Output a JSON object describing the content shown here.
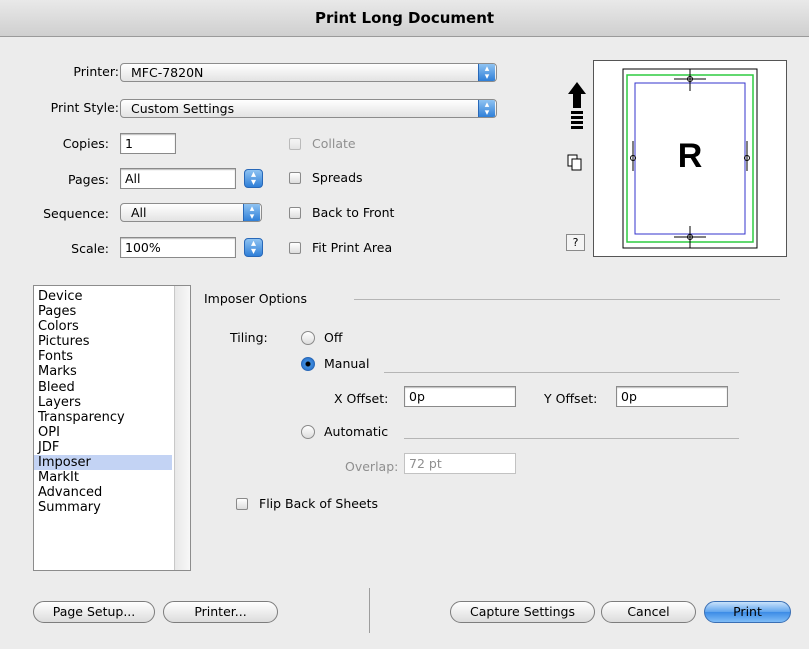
{
  "window": {
    "title": "Print Long Document"
  },
  "printer": {
    "label": "Printer:",
    "value": "MFC-7820N"
  },
  "print_style": {
    "label": "Print Style:",
    "value": "Custom Settings"
  },
  "copies": {
    "label": "Copies:",
    "value": "1"
  },
  "pages": {
    "label": "Pages:",
    "value": "All"
  },
  "sequence": {
    "label": "Sequence:",
    "value": "All"
  },
  "scale": {
    "label": "Scale:",
    "value": "100%"
  },
  "options": {
    "collate": {
      "label": "Collate",
      "checked": false,
      "enabled": false
    },
    "spreads": {
      "label": "Spreads",
      "checked": false
    },
    "back_to_front": {
      "label": "Back to Front",
      "checked": false
    },
    "fit_print_area": {
      "label": "Fit Print Area",
      "checked": false
    }
  },
  "preview": {
    "letter": "R",
    "help": "?"
  },
  "sidebar": {
    "items": [
      {
        "label": "Device"
      },
      {
        "label": "Pages"
      },
      {
        "label": "Colors"
      },
      {
        "label": "Pictures"
      },
      {
        "label": "Fonts"
      },
      {
        "label": "Marks"
      },
      {
        "label": "Bleed"
      },
      {
        "label": "Layers"
      },
      {
        "label": "Transparency"
      },
      {
        "label": "OPI"
      },
      {
        "label": "JDF"
      },
      {
        "label": "Imposer"
      },
      {
        "label": "MarkIt"
      },
      {
        "label": "Advanced"
      },
      {
        "label": "Summary"
      }
    ],
    "selected": "Imposer"
  },
  "imposer": {
    "section_title": "Imposer Options",
    "tiling_label": "Tiling:",
    "off_label": "Off",
    "manual_label": "Manual",
    "automatic_label": "Automatic",
    "selected_tiling": "Manual",
    "x_offset_label": "X Offset:",
    "x_offset_value": "0p",
    "y_offset_label": "Y Offset:",
    "y_offset_value": "0p",
    "overlap_label": "Overlap:",
    "overlap_value": "72 pt",
    "flip_label": "Flip Back of Sheets",
    "flip_checked": false
  },
  "buttons": {
    "page_setup": "Page Setup...",
    "printer": "Printer...",
    "capture_settings": "Capture Settings",
    "cancel": "Cancel",
    "print": "Print"
  },
  "colors": {
    "accent": "#3c8be6",
    "selection": "#c3d3f4",
    "crop_green": "#2ecc40",
    "margin_blue": "#3333cc"
  }
}
